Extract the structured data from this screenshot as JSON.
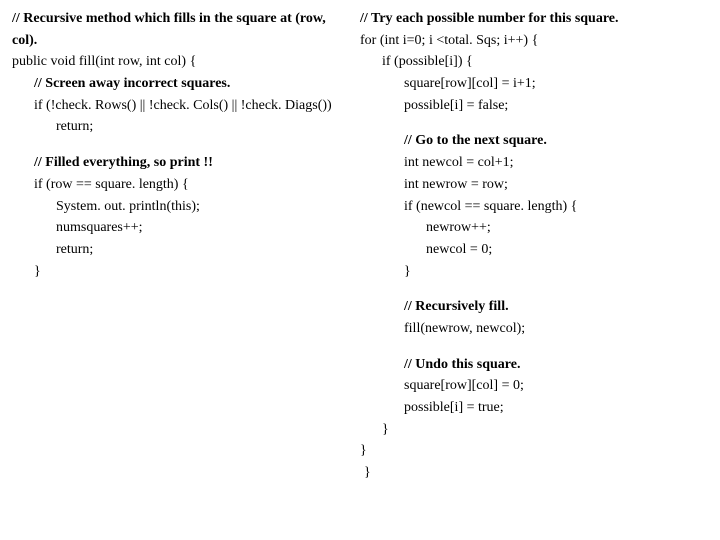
{
  "left": {
    "c1_comment": "// Recursive method which fills in the square at (row, col).",
    "c2_sig": "public void fill(int row, int col) {",
    "c3_comment": "// Screen away incorrect squares.",
    "c4_cond": "if (!check. Rows() || !check. Cols() || !check. Diags())",
    "c5_return": "return;",
    "c6_comment": "// Filled everything, so print !!",
    "c7_cond": "if (row == square. length) {",
    "c8_print": "System. out. println(this);",
    "c9_inc": "numsquares++;",
    "c10_return": "return;",
    "c11_close": "}"
  },
  "right": {
    "r1_comment": "// Try each possible number for this square.",
    "r2_for": "for (int i=0; i <total. Sqs; i++) {",
    "r3_if": "if (possible[i]) {",
    "r4_assign": "square[row][col] = i+1;",
    "r5_flag": "possible[i] = false;",
    "r6_comment": "// Go to the next square.",
    "r7_newcol": "int newcol = col+1;",
    "r8_newrow": "int newrow = row;",
    "r9_if": "if (newcol == square. length) {",
    "r10_inc": "newrow++;",
    "r11_reset": "newcol = 0;",
    "r12_close": "}",
    "r13_comment": "// Recursively fill.",
    "r14_call": "fill(newrow, newcol);",
    "r15_comment": "// Undo this square.",
    "r16_undo1": "square[row][col] = 0;",
    "r17_undo2": "possible[i] = true;",
    "r18_close_if": "}",
    "r19_close_for": "}",
    "r20_close": "}"
  }
}
